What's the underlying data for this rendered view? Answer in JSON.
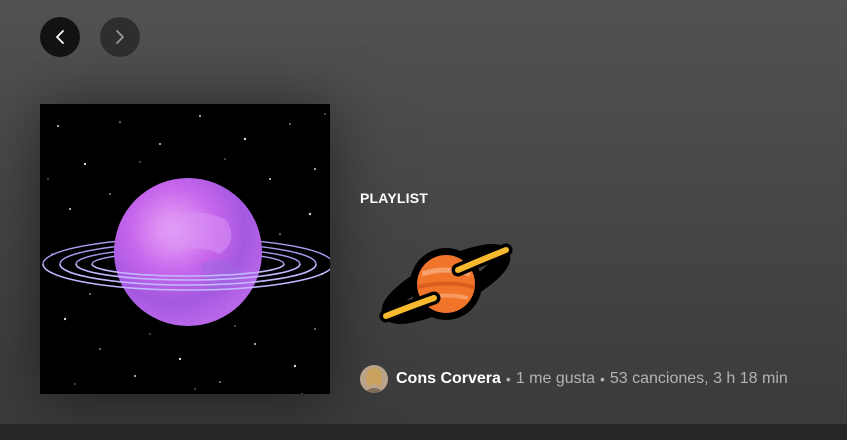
{
  "nav": {
    "back_icon": "chevron-left-icon",
    "forward_icon": "chevron-right-icon"
  },
  "playlist": {
    "type_label": "PLAYLIST",
    "title_emoji": "🪐",
    "owner_name": "Cons Corvera",
    "likes": "1 me gusta",
    "songs_and_duration": "53 canciones, 3 h 18 min",
    "separator": "•"
  },
  "colors": {
    "header_bg": "#525252",
    "nav_back_bg": "#131313",
    "nav_forward_bg": "#2f2f2f",
    "planet_purple": "#c260ea",
    "emoji_planet_orange": "#f0742a",
    "emoji_ring_yellow": "#f7b92e",
    "meta_text": "#b3b3b3"
  }
}
